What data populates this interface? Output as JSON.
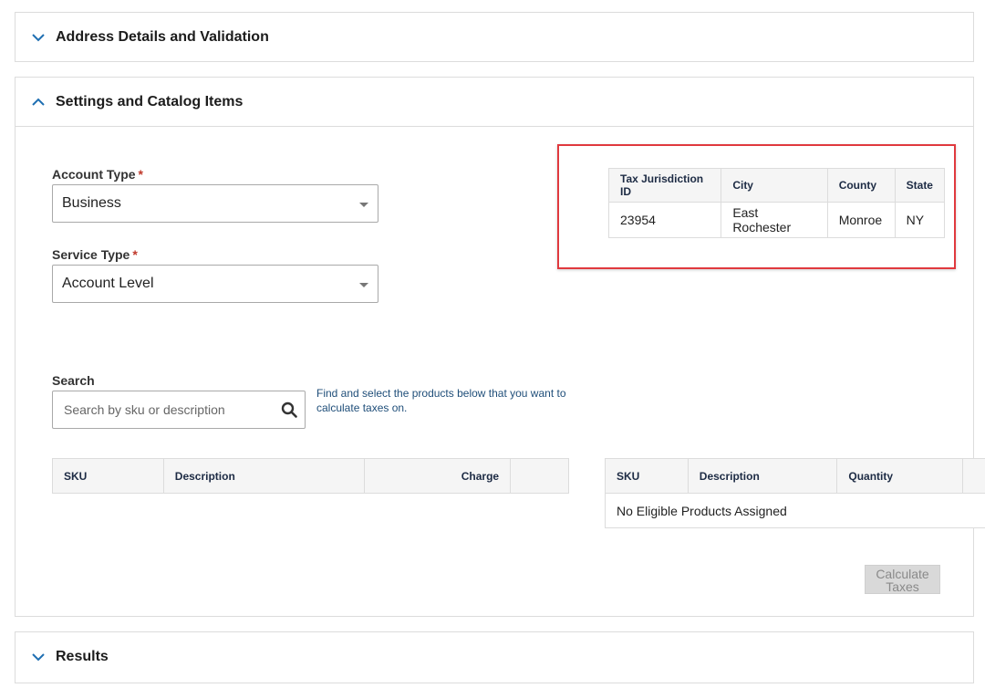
{
  "panels": {
    "address": {
      "title": "Address Details and Validation",
      "state": "collapsed"
    },
    "settings": {
      "title": "Settings and Catalog Items",
      "state": "expanded"
    },
    "results": {
      "title": "Results",
      "state": "collapsed"
    }
  },
  "form": {
    "account_type": {
      "label": "Account Type",
      "required_mark": "*",
      "value": "Business"
    },
    "service_type": {
      "label": "Service Type",
      "required_mark": "*",
      "value": "Account Level"
    }
  },
  "tax_jurisdiction": {
    "headers": [
      "Tax Jurisdiction ID",
      "City",
      "County",
      "State"
    ],
    "row": [
      "23954",
      "East Rochester",
      "Monroe",
      "NY"
    ],
    "highlight_color": "#e0393e"
  },
  "search": {
    "label": "Search",
    "placeholder": "Search by sku or description",
    "hint": "Find and select the products below that you want to calculate taxes on."
  },
  "catalog_table": {
    "headers": [
      "SKU",
      "Description",
      "Charge",
      ""
    ]
  },
  "assigned_table": {
    "headers": [
      "SKU",
      "Description",
      "Quantity"
    ],
    "empty_message": "No Eligible Products Assigned"
  },
  "actions": {
    "calculate_label": "Calculate Taxes",
    "calculate_enabled": false
  },
  "icons": {
    "chevron": "chevron-icon",
    "search": "search-icon",
    "dropdown": "dropdown-caret-icon"
  },
  "colors": {
    "chevron": "#1f6fb2",
    "hint_text": "#1f4e79",
    "required": "#c0392b"
  }
}
